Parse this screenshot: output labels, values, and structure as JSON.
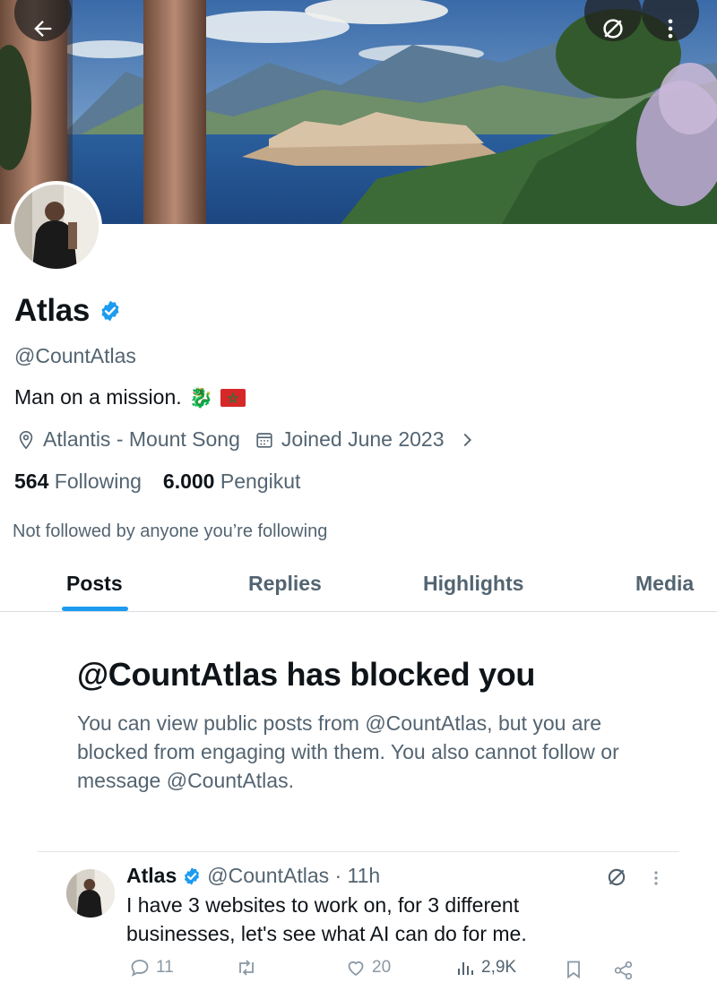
{
  "banner": {
    "description_icon": "coastal-landscape-banner"
  },
  "header": {
    "back_icon": "arrow-left-icon",
    "mute_icon": "mute-slash-icon",
    "more_icon": "more-vertical-icon"
  },
  "profile": {
    "name": "Atlas",
    "verified_icon": "verified-badge-icon",
    "handle": "@CountAtlas",
    "bio_text": "Man on a mission.",
    "bio_emojis": [
      "🐉",
      "🇲🇦"
    ],
    "location": "Atlantis - Mount Song",
    "joined": "Joined June 2023",
    "following_count": "564",
    "following_label": "Following",
    "followers_count": "6.000",
    "followers_label": "Pengikut",
    "not_followed": "Not followed by anyone you’re following"
  },
  "tabs": [
    {
      "label": "Posts",
      "active": true
    },
    {
      "label": "Replies",
      "active": false
    },
    {
      "label": "Highlights",
      "active": false
    },
    {
      "label": "Media",
      "active": false
    }
  ],
  "blocked": {
    "title": "@CountAtlas has blocked you",
    "text": "You can view public posts from @CountAtlas, but you are blocked from engaging with them. You also cannot follow or message @CountAtlas."
  },
  "tweet": {
    "name": "Atlas",
    "handle_time": "@CountAtlas · 11h",
    "body": "I have 3 websites to work on, for 3 different businesses, let's see what AI can do for me.",
    "replies": "11",
    "retweets": "",
    "likes": "20",
    "views": "2,9K"
  },
  "colors": {
    "accent": "#1d9bf0",
    "text": "#0f1419",
    "secondary": "#536471",
    "divider": "#d9dee2"
  }
}
